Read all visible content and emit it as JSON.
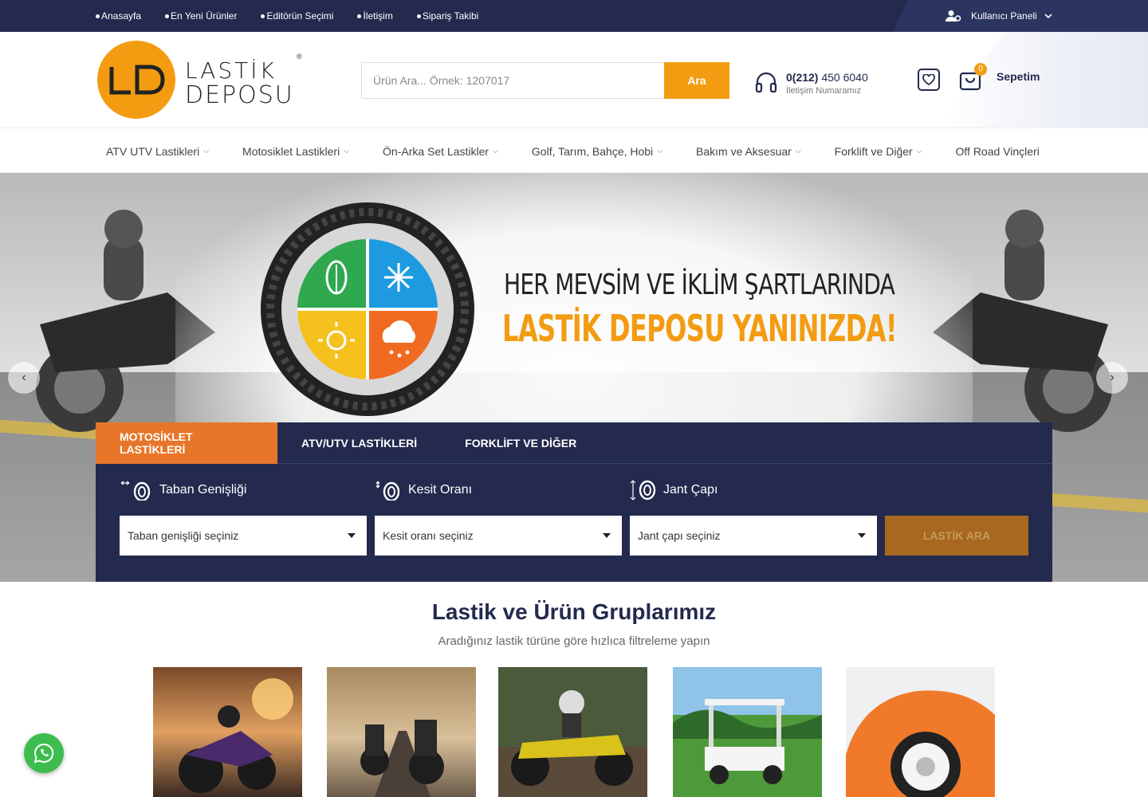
{
  "topbar": {
    "links": [
      "Anasayfa",
      "En Yeni Ürünler",
      "Editörün Seçimi",
      "İletişim",
      "Sipariş Takibi"
    ],
    "user_panel": "Kullanıcı Paneli"
  },
  "logo": {
    "mark": "LD",
    "word1": "LASTİK",
    "word2": "DEPOSU",
    "reg": "®"
  },
  "search": {
    "placeholder": "Ürün Ara... Örnek: 1207017",
    "button": "Ara"
  },
  "contact": {
    "phone_prefix": "0(212)",
    "phone_number": " 450 6040",
    "label": "İletişim Numaramız"
  },
  "cart": {
    "count": "0",
    "label": "Sepetim"
  },
  "nav": [
    "ATV UTV Lastikleri",
    "Motosiklet Lastikleri",
    "Ön-Arka Set Lastikler",
    "Golf, Tarım, Bahçe, Hobi",
    "Bakım ve Aksesuar",
    "Forklift ve Diğer",
    "Off Road Vinçleri"
  ],
  "hero": {
    "line1": "HER MEVSİM VE İKLİM ŞARTLARINDA",
    "line2": "LASTİK DEPOSU YANINIZDA!"
  },
  "finder": {
    "tabs": [
      "MOTOSİKLET LASTİKLERİ",
      "ATV/UTV LASTİKLERİ",
      "FORKLİFT VE DİĞER"
    ],
    "labels": [
      "Taban Genişliği",
      "Kesit Oranı",
      "Jant Çapı"
    ],
    "selects": [
      "Taban genişliği seçiniz",
      "Kesit oranı seçiniz",
      "Jant çapı seçiniz"
    ],
    "button": "LASTİK ARA"
  },
  "groups": {
    "title": "Lastik ve Ürün Gruplarımız",
    "subtitle": "Aradığınız lastik türüne göre hızlıca filtreleme yapın"
  },
  "colors": {
    "navy": "#232a4e",
    "orange": "#f39c12",
    "tab_orange": "#e8762a",
    "whatsapp": "#3ebd4f"
  }
}
